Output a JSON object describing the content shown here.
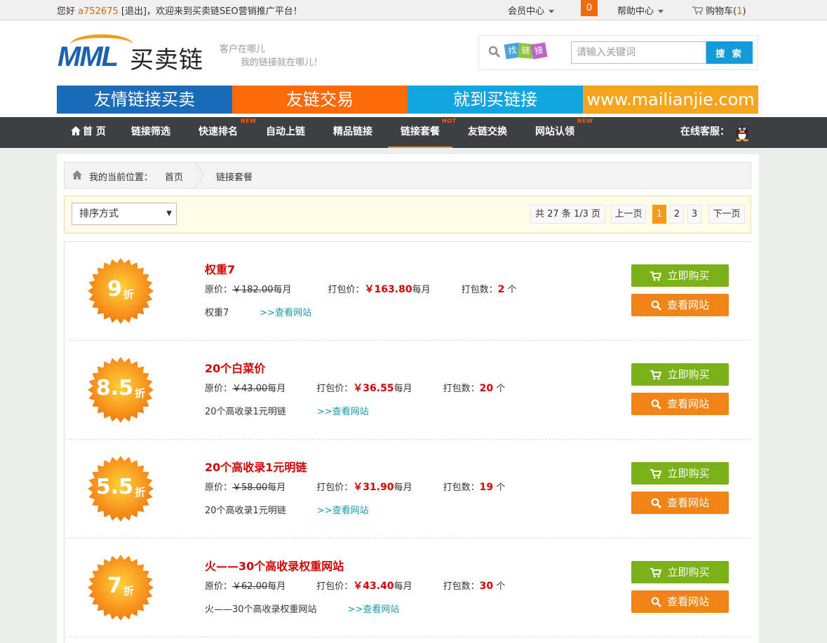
{
  "topbar": {
    "greeting_prefix": "您好",
    "username": "a752675",
    "logout": "[退出]",
    "welcome": "，欢迎来到买卖链SEO营销推广平台！",
    "member_center": "会员中心",
    "message_count": "0",
    "help_center": "帮助中心",
    "cart_label": "购物车(",
    "cart_count": "1",
    "cart_close": ")"
  },
  "header": {
    "logo_mark": "MML",
    "logo_text": "买卖链",
    "slogan_line1": "客户在哪儿",
    "slogan_line2": "我的链接就在哪儿！",
    "search_tags": [
      "找",
      "链",
      "接"
    ],
    "search_placeholder": "请输入关键词",
    "search_button": "搜 索",
    "banner": [
      "友情链接买卖",
      "友链交易",
      "就到买链接",
      "www.mailianjie.com"
    ]
  },
  "nav": {
    "items": [
      {
        "label": "首 页",
        "badge": ""
      },
      {
        "label": "链接筛选",
        "badge": ""
      },
      {
        "label": "快速排名",
        "badge": "NEW"
      },
      {
        "label": "自动上链",
        "badge": ""
      },
      {
        "label": "精品链接",
        "badge": ""
      },
      {
        "label": "链接套餐",
        "badge": "HOT"
      },
      {
        "label": "友链交换",
        "badge": ""
      },
      {
        "label": "网站认领",
        "badge": "NEW"
      }
    ],
    "service_label": "在线客服："
  },
  "breadcrumb": {
    "label": "我的当前位置：",
    "home": "首页",
    "current": "链接套餐"
  },
  "filter": {
    "sort_label": "排序方式",
    "summary": "共 27 条 1/3 页",
    "prev": "上一页",
    "pages": [
      "1",
      "2",
      "3"
    ],
    "current_page": "1",
    "next": "下一页"
  },
  "packages": [
    {
      "discount": "9",
      "discount_unit": "折",
      "title": "权重7",
      "orig_label": "原价：",
      "orig_price": "￥182.00",
      "per": "每月",
      "pack_label": "打包价：",
      "pack_price": "￥163.80",
      "count_label": "打包数：",
      "count": "2",
      "count_unit": " 个",
      "desc": "权重7",
      "view_link": ">>查看网站",
      "buy_button": "立即购买",
      "view_button": "查看网站"
    },
    {
      "discount": "8.5",
      "discount_unit": "折",
      "title": "20个白菜价",
      "orig_label": "原价：",
      "orig_price": "￥43.00",
      "per": "每月",
      "pack_label": "打包价：",
      "pack_price": "￥36.55",
      "count_label": "打包数：",
      "count": "20",
      "count_unit": " 个",
      "desc": "20个高收录1元明链",
      "view_link": ">>查看网站",
      "buy_button": "立即购买",
      "view_button": "查看网站"
    },
    {
      "discount": "5.5",
      "discount_unit": "折",
      "title": "20个高收录1元明链",
      "orig_label": "原价：",
      "orig_price": "￥58.00",
      "per": "每月",
      "pack_label": "打包价：",
      "pack_price": "￥31.90",
      "count_label": "打包数：",
      "count": "19",
      "count_unit": " 个",
      "desc": "20个高收录1元明链",
      "view_link": ">>查看网站",
      "buy_button": "立即购买",
      "view_button": "查看网站"
    },
    {
      "discount": "7",
      "discount_unit": "折",
      "title": "火——30个高收录权重网站",
      "orig_label": "原价：",
      "orig_price": "￥62.00",
      "per": "每月",
      "pack_label": "打包价：",
      "pack_price": "￥43.40",
      "count_label": "打包数：",
      "count": "30",
      "count_unit": " 个",
      "desc": "火——30个高收录权重网站",
      "view_link": ">>查看网站",
      "buy_button": "立即购买",
      "view_button": "查看网站"
    }
  ],
  "colors": {
    "brand_blue": "#1c62b0",
    "brand_orange": "#f39a1e",
    "nav_bg": "#3d3f42",
    "price_red": "#d40000",
    "buy_green": "#7ab116",
    "view_orange": "#f08416",
    "search_blue": "#129bd6",
    "link_teal": "#169ba5"
  },
  "icons": [
    "home-icon",
    "chevron-down-icon",
    "cart-icon",
    "search-icon",
    "qq-penguin-icon",
    "discount-burst-icon"
  ]
}
